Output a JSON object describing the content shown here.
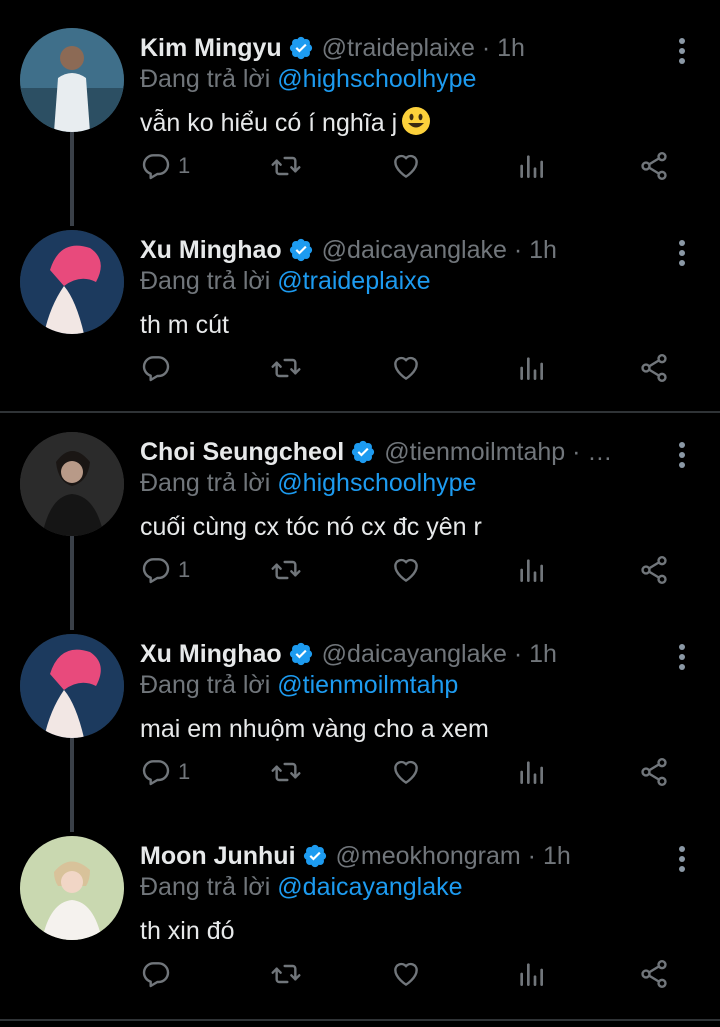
{
  "colors": {
    "background": "#000000",
    "link": "#1d9bf0",
    "muted": "#71767b",
    "verified": "#1d9bf0"
  },
  "tweets": [
    {
      "name": "Kim Mingyu",
      "handle": "@traideplaixe",
      "time": "· 1h",
      "replying_prefix": "Đang trả lời",
      "replying_to": "@highschoolhype",
      "text": "vẫn ko hiểu có í nghĩa j",
      "has_emoji": true,
      "reply_count": "1"
    },
    {
      "name": "Xu Minghao",
      "handle": "@daicayanglake",
      "time": "· 1h",
      "replying_prefix": "Đang trả lời",
      "replying_to": "@traideplaixe",
      "text": "th m cút",
      "reply_count": ""
    },
    {
      "name": "Choi Seungcheol",
      "handle": "@tienmoilmtahp",
      "time": "· …",
      "replying_prefix": "Đang trả lời",
      "replying_to": "@highschoolhype",
      "text": "cuối cùng cx tóc nó cx đc yên r",
      "reply_count": "1"
    },
    {
      "name": "Xu Minghao",
      "handle": "@daicayanglake",
      "time": "· 1h",
      "replying_prefix": "Đang trả lời",
      "replying_to": "@tienmoilmtahp",
      "text": "mai em nhuộm vàng cho a xem",
      "reply_count": "1"
    },
    {
      "name": "Moon Junhui",
      "handle": "@meokhongram",
      "time": "· 1h",
      "replying_prefix": "Đang trả lời",
      "replying_to": "@daicayanglake",
      "text": "th xin đó",
      "reply_count": ""
    }
  ],
  "icons": {
    "reply": "reply-icon",
    "retweet": "retweet-icon",
    "like": "heart-icon",
    "stats": "analytics-icon",
    "share": "share-icon",
    "more": "more-icon",
    "verified": "verified-badge-icon"
  }
}
